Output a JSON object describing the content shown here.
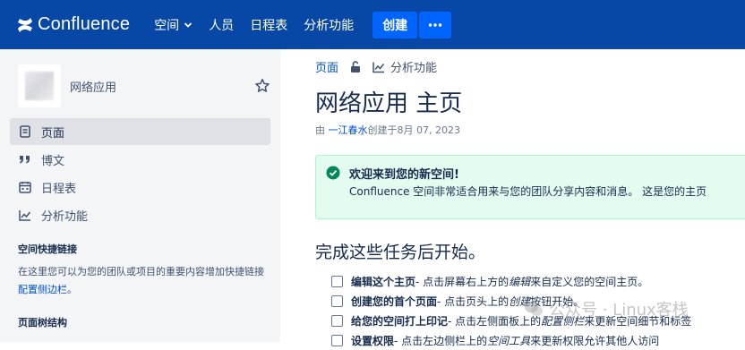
{
  "topbar": {
    "app_name": "Confluence",
    "nav": [
      {
        "label": "空间",
        "has_dropdown": true
      },
      {
        "label": "人员"
      },
      {
        "label": "日程表"
      },
      {
        "label": "分析功能"
      }
    ],
    "create_label": "创建",
    "more_label": "•••",
    "color": "#0747a6",
    "button_color": "#0065ff"
  },
  "sidebar": {
    "space_name": "网络应用",
    "items": [
      {
        "label": "页面",
        "icon": "page-icon",
        "active": true
      },
      {
        "label": "博文",
        "icon": "quote-icon"
      },
      {
        "label": "日程表",
        "icon": "calendar-icon"
      },
      {
        "label": "分析功能",
        "icon": "analytics-icon"
      }
    ],
    "shortcuts_title": "空间快捷链接",
    "shortcuts_desc_prefix": "在这里您可以为您的团队或项目的重要内容增加快捷链接",
    "shortcuts_link": "配置侧边栏",
    "shortcuts_desc_suffix": "。",
    "tree_title": "页面树结构"
  },
  "main": {
    "breadcrumb": {
      "pages": "页面",
      "analytics": "分析功能"
    },
    "title": "网络应用 主页",
    "byline_prefix": "由",
    "author": "一江春水",
    "byline_suffix": "创建于8月 07, 2023",
    "panel": {
      "title": "欢迎来到您的新空间!",
      "text": "Confluence 空间非常适合用来与您的团队分享内容和消息。 这是您的主页",
      "color": "#e3fcef"
    },
    "tasks_heading": "完成这些任务后开始。",
    "tasks": [
      {
        "bold": "编辑这个主页",
        "a": " - 点击屏幕右上方的",
        "em": "编辑",
        "b": "来自定义您的空间主页。"
      },
      {
        "bold": "创建您的首个页面",
        "a": " - 点击页头上的",
        "em": "创建",
        "b": "按钮开始。"
      },
      {
        "bold": "给您的空间打上印记",
        "a": " - 点击左侧面板上的",
        "em": "配置侧栏",
        "b": "来更新空间细节和标签"
      },
      {
        "bold": "设置权限",
        "a": " - 点击左边侧栏上的",
        "em": "空间工具",
        "b": "来更新权限允许其他人访问"
      }
    ]
  },
  "watermark": "公众号 · Linux客栈"
}
